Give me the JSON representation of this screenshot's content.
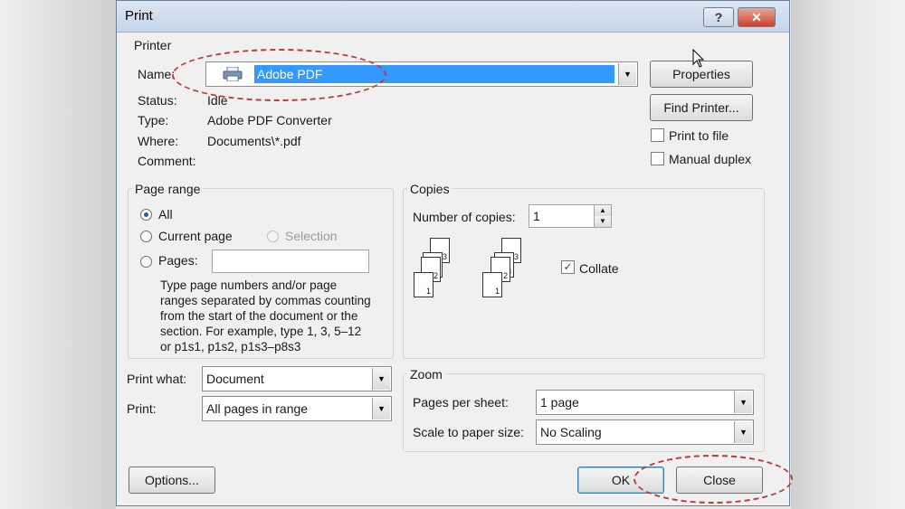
{
  "window": {
    "title": "Print",
    "help": "?",
    "close_glyph": "✕"
  },
  "printer": {
    "group_title": "Printer",
    "name_label": "Name:",
    "name_value": "Adobe PDF",
    "status_label": "Status:",
    "status_value": "Idle",
    "type_label": "Type:",
    "type_value": "Adobe PDF Converter",
    "where_label": "Where:",
    "where_value": "Documents\\*.pdf",
    "comment_label": "Comment:",
    "comment_value": "",
    "properties_button": "Properties",
    "find_printer_button": "Find Printer...",
    "print_to_file": "Print to file",
    "manual_duplex": "Manual duplex"
  },
  "page_range": {
    "group_title": "Page range",
    "all": "All",
    "current_page": "Current page",
    "selection": "Selection",
    "pages": "Pages:",
    "pages_value": "",
    "help_text_lines": [
      "Type page numbers and/or page",
      "ranges separated by commas counting",
      "from the start of the document or the",
      "section. For example, type 1, 3, 5–12",
      "or p1s1, p1s2, p1s3–p8s3"
    ]
  },
  "copies": {
    "group_title": "Copies",
    "number_label": "Number of copies:",
    "number_value": "1",
    "collate": "Collate",
    "page_numbers": [
      "1",
      "2",
      "3"
    ]
  },
  "print_what": {
    "label": "Print what:",
    "value": "Document"
  },
  "print": {
    "label": "Print:",
    "value": "All pages in range"
  },
  "zoom": {
    "group_title": "Zoom",
    "pages_per_sheet_label": "Pages per sheet:",
    "pages_per_sheet_value": "1 page",
    "scale_label": "Scale to paper size:",
    "scale_value": "No Scaling"
  },
  "buttons": {
    "options": "Options...",
    "ok": "OK",
    "close": "Close"
  },
  "icons": {
    "dropdown_arrow": "▼",
    "spin_up": "▲",
    "spin_down": "▼",
    "check": "✓"
  },
  "colors": {
    "selection": "#3399ff",
    "annotation": "#c0393b",
    "titlebar": "#c5d5ea"
  }
}
